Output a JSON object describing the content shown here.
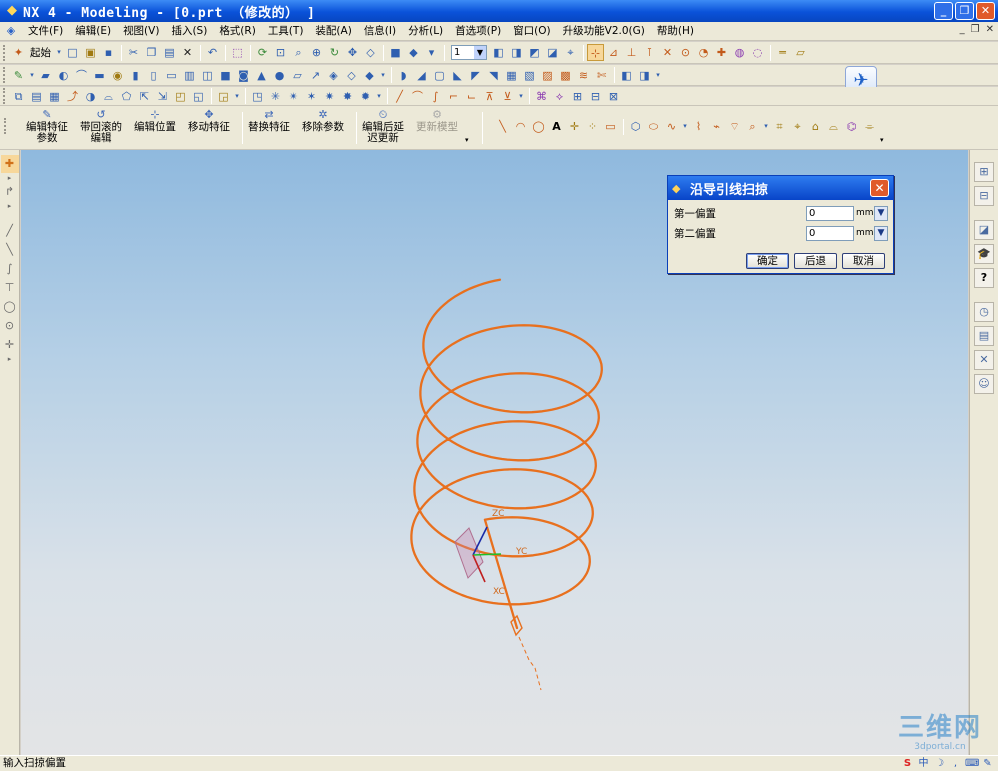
{
  "window": {
    "title": "NX 4 - Modeling - [0.prt （修改的） ]",
    "min": "_",
    "restore": "❐",
    "close": "✕"
  },
  "menubar": {
    "items": [
      "文件(F)",
      "编辑(E)",
      "视图(V)",
      "插入(S)",
      "格式(R)",
      "工具(T)",
      "装配(A)",
      "信息(I)",
      "分析(L)",
      "首选项(P)",
      "窗口(O)",
      "升级功能V2.0(G)",
      "帮助(H)"
    ],
    "right_controls": [
      "_",
      "❐",
      "✕"
    ]
  },
  "toolbar": {
    "start_label": "起始",
    "layer_value": "1"
  },
  "feature_toolbar": {
    "buttons": [
      {
        "line1": "编辑特征",
        "line2": "参数",
        "enabled": true
      },
      {
        "line1": "带回滚的",
        "line2": "编辑",
        "enabled": true
      },
      {
        "line1": "编辑位置",
        "line2": "",
        "enabled": true
      },
      {
        "line1": "移动特征",
        "line2": "",
        "enabled": true
      },
      {
        "line1": "替换特征",
        "line2": "",
        "enabled": true
      },
      {
        "line1": "移除参数",
        "line2": "",
        "enabled": true
      },
      {
        "line1": "编辑后延",
        "line2": "迟更新",
        "enabled": true
      },
      {
        "line1": "更新模型",
        "line2": "",
        "enabled": false
      }
    ]
  },
  "viewport": {
    "axes": {
      "z": "ZC",
      "y": "YC",
      "x": "XC"
    },
    "curve_color": "#e8701e"
  },
  "dialog": {
    "title": "沿导引线扫掠",
    "fields": [
      {
        "label": "第一偏置",
        "value": "0",
        "unit": "mm"
      },
      {
        "label": "第二偏置",
        "value": "0",
        "unit": "mm"
      }
    ],
    "buttons": {
      "ok": "确定",
      "back": "后退",
      "cancel": "取消"
    }
  },
  "statusbar": {
    "prompt": "输入扫掠偏置"
  },
  "watermark": {
    "line1": "三维网",
    "line2": "3dportal.cn"
  }
}
